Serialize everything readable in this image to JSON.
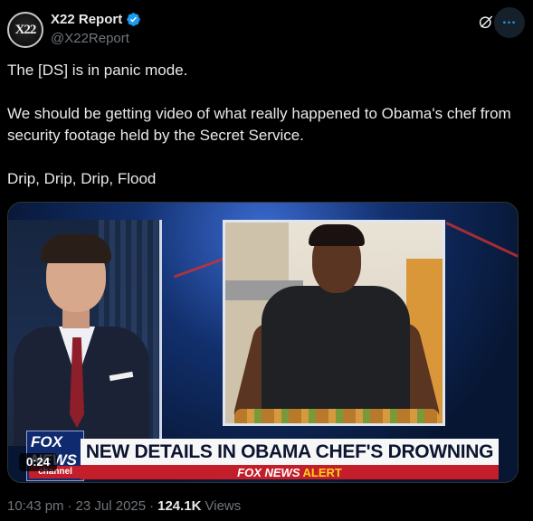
{
  "author": {
    "avatar_text": "X22",
    "name": "X22 Report",
    "handle": "@X22Report",
    "verified": true
  },
  "tweet": {
    "lines": [
      "The [DS] is in panic mode.",
      "We should be getting video of what really happened to Obama's chef from security footage held by the Secret Service.",
      "Drip, Drip, Drip, Flood"
    ]
  },
  "media": {
    "duration": "0:24",
    "headline": "NEW DETAILS IN OBAMA CHEF'S DROWNING",
    "channel_logo_top": "FOX NEWS",
    "channel_logo_bottom": "channel",
    "alert_prefix": "FOX NEWS",
    "alert_suffix": "ALERT"
  },
  "meta": {
    "time": "10:43 pm",
    "separator": "·",
    "date": "23 Jul 2025",
    "views_count": "124.1K",
    "views_label": "Views"
  },
  "icons": {
    "grok": "grok-icon",
    "more": "more-icon",
    "verified": "verified-badge-icon"
  },
  "colors": {
    "accent": "#1d9bf0",
    "background": "#000000",
    "muted": "#71767b"
  }
}
